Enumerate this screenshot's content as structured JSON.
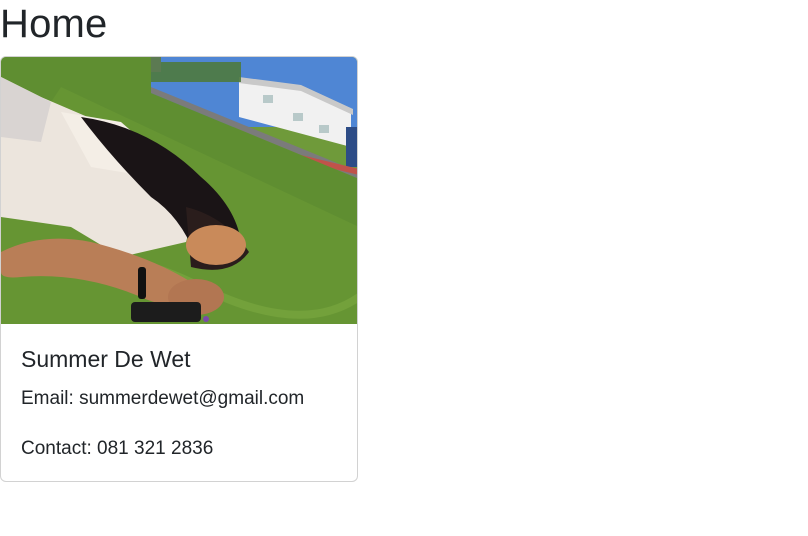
{
  "page": {
    "title": "Home"
  },
  "card": {
    "image_description_icon": "photo",
    "name": "Summer De Wet",
    "email_label": "Email:",
    "email": "summerdewet@gmail.com",
    "contact_label": "Contact:",
    "contact": "081 321 2836"
  }
}
